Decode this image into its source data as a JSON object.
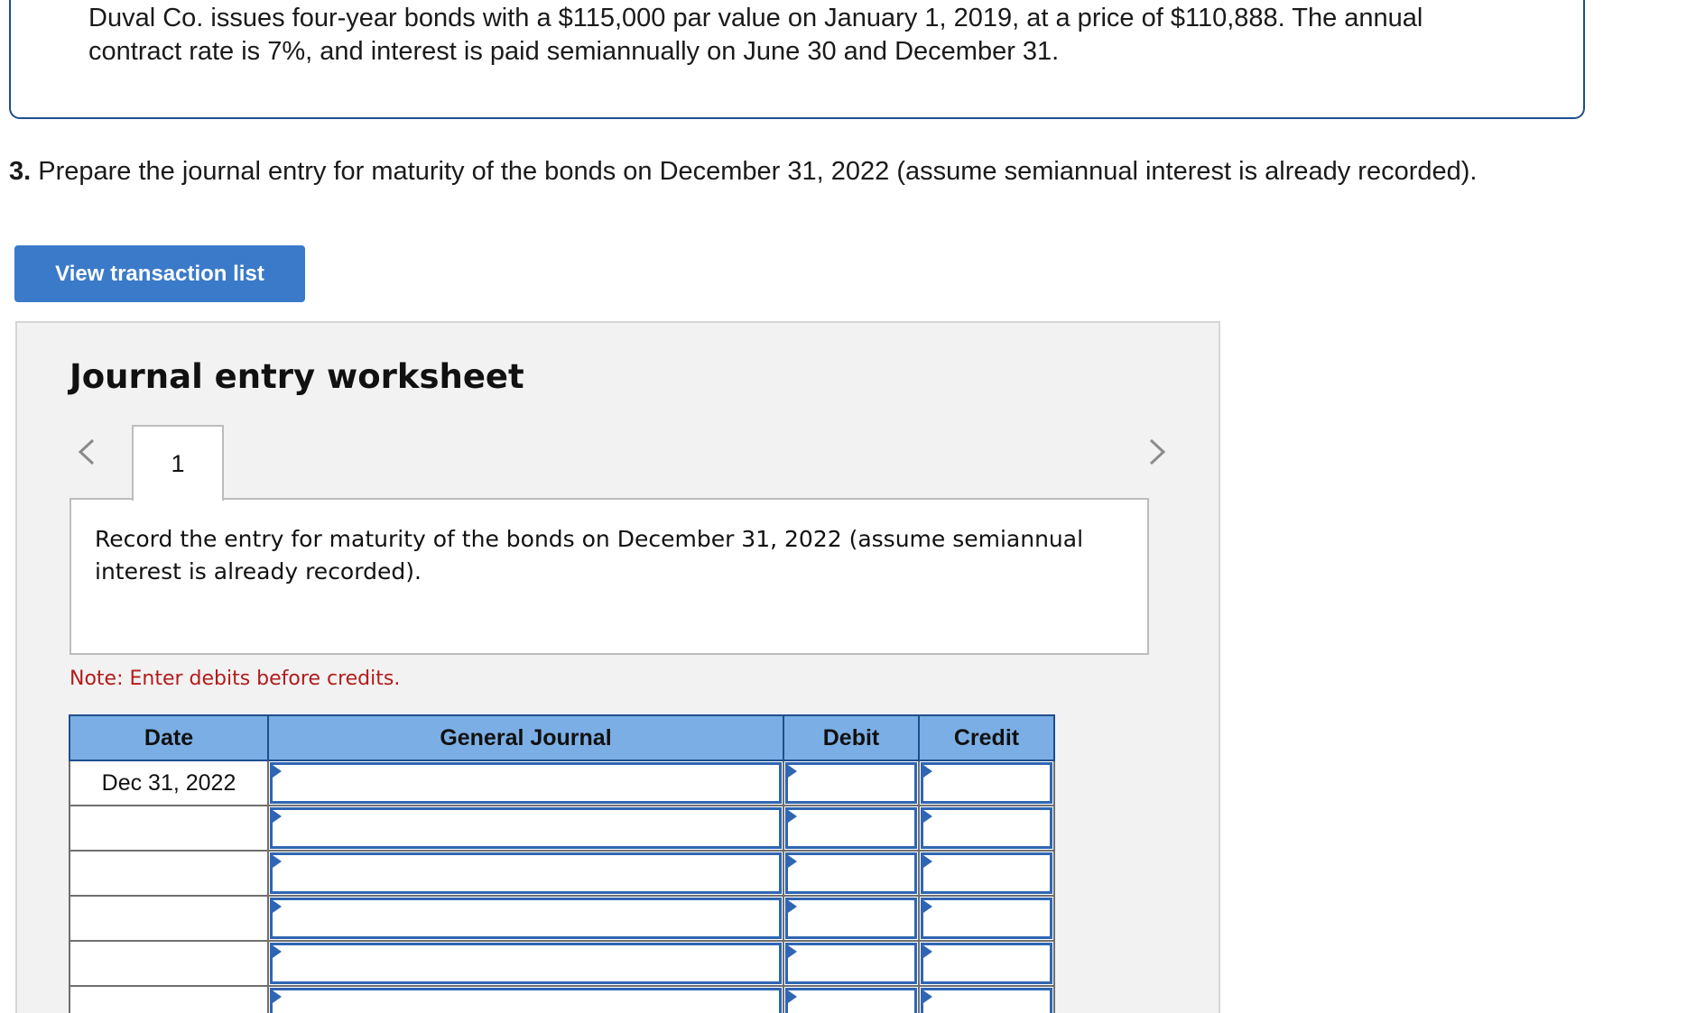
{
  "problem": {
    "text": "Duval Co. issues four-year bonds with a $115,000 par value on January 1, 2019, at a price of $110,888. The annual contract rate is 7%, and interest is paid semiannually on June 30 and December 31."
  },
  "question": {
    "number": "3.",
    "text": " Prepare the journal entry for maturity of the bonds on December 31, 2022 (assume semiannual interest is already recorded)."
  },
  "view_transaction_button": {
    "label": "View transaction list"
  },
  "worksheet": {
    "title": "Journal entry worksheet",
    "tab_label": "1",
    "instruction": "Record the entry for maturity of the bonds on December 31, 2022 (assume semiannual interest is already recorded).",
    "note": "Note: Enter debits before credits.",
    "table": {
      "headers": {
        "date": "Date",
        "general_journal": "General Journal",
        "debit": "Debit",
        "credit": "Credit"
      },
      "rows": [
        {
          "date": "Dec 31, 2022",
          "account": "",
          "debit": "",
          "credit": ""
        },
        {
          "date": "",
          "account": "",
          "debit": "",
          "credit": ""
        },
        {
          "date": "",
          "account": "",
          "debit": "",
          "credit": ""
        },
        {
          "date": "",
          "account": "",
          "debit": "",
          "credit": ""
        },
        {
          "date": "",
          "account": "",
          "debit": "",
          "credit": ""
        },
        {
          "date": "",
          "account": "",
          "debit": "",
          "credit": ""
        }
      ]
    }
  },
  "icons": {
    "prev": "chevron-left-icon",
    "next": "chevron-right-icon"
  },
  "colors": {
    "button_bg": "#3a7ac9",
    "header_bg": "#7baee5",
    "note_text": "#b31b1b",
    "input_border": "#2f66b3",
    "worksheet_bg": "#f2f2f2"
  }
}
